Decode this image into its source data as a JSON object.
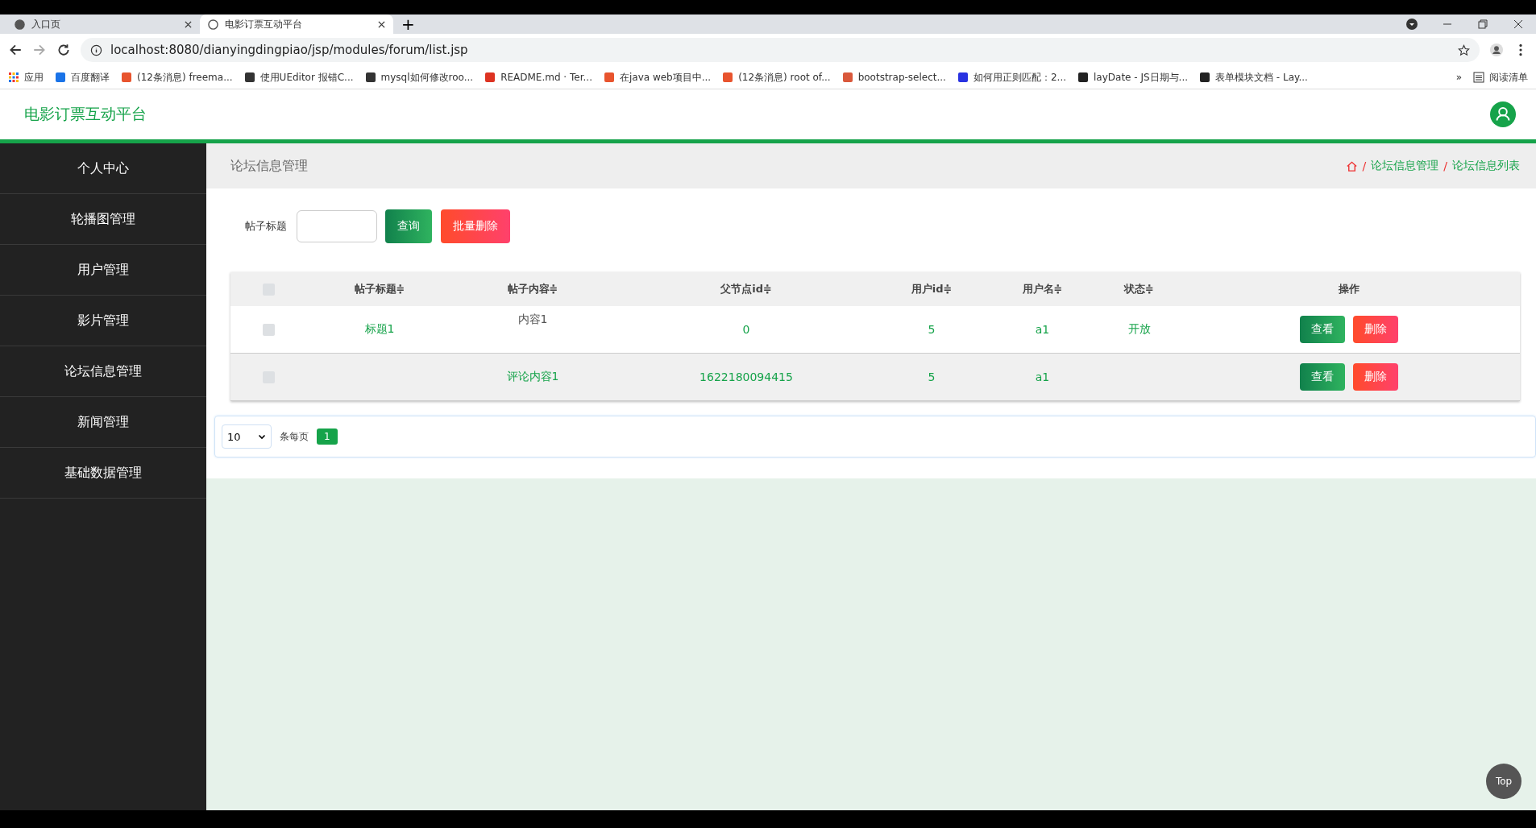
{
  "browser": {
    "tabs": [
      {
        "title": "入口页",
        "selected": false
      },
      {
        "title": "电影订票互动平台",
        "selected": true
      }
    ],
    "new_tab": "+",
    "url": "localhost:8080/dianyingdingpiao/jsp/modules/forum/list.jsp",
    "bookmarks": [
      "应用",
      "百度翻译",
      "(12条消息) freema...",
      "使用UEditor 报错C...",
      "mysql如何修改roo...",
      "README.md · Ter...",
      "在java web项目中...",
      "(12条消息) root of...",
      "bootstrap-select...",
      "如何用正则匹配：2...",
      "layDate - JS日期与...",
      "表单模块文档 - Lay..."
    ],
    "overflow": "»",
    "reading_list": "阅读清单"
  },
  "app": {
    "title": "电影订票互动平台"
  },
  "sidebar": {
    "items": [
      {
        "label": "个人中心",
        "selected": false
      },
      {
        "label": "轮播图管理",
        "selected": false
      },
      {
        "label": "用户管理",
        "selected": false
      },
      {
        "label": "影片管理",
        "selected": false
      },
      {
        "label": "论坛信息管理",
        "selected": false
      },
      {
        "label": "新闻管理",
        "selected": false
      },
      {
        "label": "基础数据管理",
        "selected": false
      }
    ]
  },
  "page": {
    "heading": "论坛信息管理",
    "breadcrumb": [
      "论坛信息管理",
      "论坛信息列表"
    ],
    "separator": "/"
  },
  "search": {
    "label": "帖子标题",
    "query_button": "查询",
    "batch_delete_button": "批量删除"
  },
  "table": {
    "header_checked": false,
    "columns": [
      "帖子标题",
      "帖子内容",
      "父节点id",
      "用户id",
      "用户名",
      "状态",
      "操作"
    ],
    "sort_mark": "≑",
    "rows": [
      {
        "checked": false,
        "title": "标题1",
        "content": "内容1",
        "content_link": false,
        "parent_id": "0",
        "user_id": "5",
        "username": "a1",
        "status": "开放",
        "actions": [
          "查看",
          "删除"
        ]
      },
      {
        "checked": false,
        "content": "评论内容1",
        "content_link": true,
        "parent_id": "1622180094415",
        "user_id": "5",
        "username": "a1",
        "actions": [
          "查看",
          "删除"
        ]
      }
    ]
  },
  "pagination": {
    "page_size": "10",
    "per_page_label": "条每页",
    "pages": [
      {
        "label": "1",
        "selected": true
      }
    ]
  },
  "back_to_top": "Top"
}
